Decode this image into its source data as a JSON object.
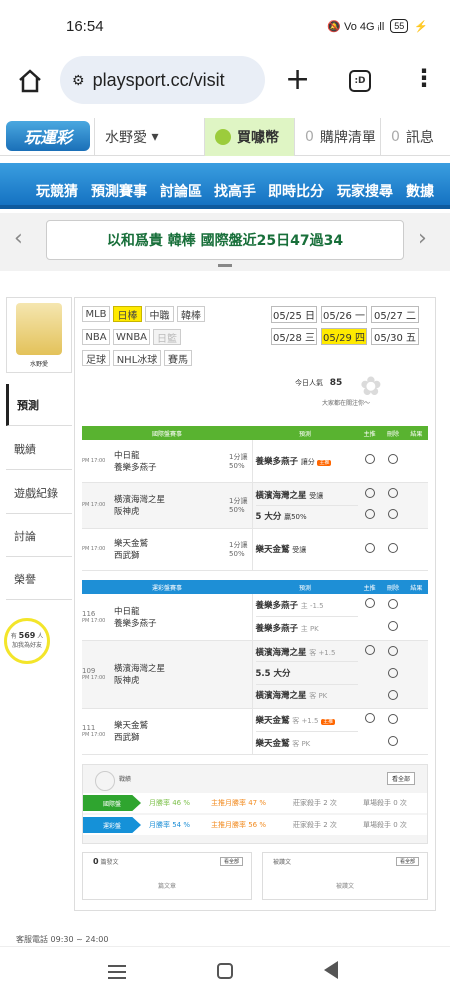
{
  "status": {
    "time": "16:54",
    "icons": "🔕 Vo 4G ᵢll",
    "battery": "55"
  },
  "browser": {
    "url": "playsport.cc/visit",
    "plus": "+",
    "tabs": ":D",
    "menu": "⋮"
  },
  "site": {
    "logo": "玩運彩",
    "user": "水野愛",
    "user_caret": "▾",
    "coins": "買噱幣",
    "cart_count": "0",
    "cart": "購牌清單",
    "msg_count": "0",
    "msg": "訊息"
  },
  "mainnav": [
    "玩競猜",
    "預測賽事",
    "討論區",
    "找高手",
    "即時比分",
    "玩家搜尋",
    "數據"
  ],
  "news": "以和爲貴 韓棒 國際盤近25日47過34",
  "sidebar": {
    "avatar_name": "水野愛",
    "items": [
      "預測",
      "戰績",
      "遊戲紀錄",
      "討論",
      "榮譽"
    ],
    "fans_prefix": "有",
    "fans": "569",
    "fans_unit": "人",
    "fans_text": "加我為好友"
  },
  "sports": [
    "MLB",
    "日棒",
    "中職",
    "韓棒",
    "NBA",
    "WNBA",
    "日籃",
    "足球",
    "NHL冰球",
    "賽馬"
  ],
  "dates": [
    "05/25 日",
    "05/26 一",
    "05/27 二",
    "05/28 三",
    "05/29 四",
    "05/30 五"
  ],
  "popularity": {
    "label": "今日人氣",
    "value": "85",
    "note": "大家都在關注你～"
  },
  "intl": {
    "header": [
      "國際盤賽事",
      "預測",
      "主推",
      "刪除",
      "結果"
    ],
    "games": [
      {
        "time": "PM 17:00",
        "teams": [
          "中日龍",
          "養樂多燕子"
        ],
        "line": "1分讓",
        "pct": "50%",
        "preds": [
          {
            "team": "養樂多燕子",
            "note": "讓分",
            "tag": "主推"
          }
        ]
      },
      {
        "time": "PM 17:00",
        "teams": [
          "橫濱海灣之星",
          "阪神虎"
        ],
        "line": "1分讓",
        "pct": "50%",
        "preds": [
          {
            "team": "橫濱海灣之星",
            "note": "受讓",
            "tag": ""
          },
          {
            "team": "5 大分",
            "note": "贏50%",
            "tag": ""
          }
        ]
      },
      {
        "time": "PM 17:00",
        "teams": [
          "樂天金鷲",
          "西武獅"
        ],
        "line": "1分讓",
        "pct": "50%",
        "preds": [
          {
            "team": "樂天金鷲",
            "note": "受讓",
            "tag": ""
          }
        ]
      }
    ]
  },
  "tw": {
    "header": [
      "運彩盤賽事",
      "預測",
      "主推",
      "刪除",
      "結果"
    ],
    "games": [
      {
        "no": "116",
        "time": "PM 17:00",
        "teams": [
          "中日龍",
          "養樂多燕子"
        ],
        "preds": [
          {
            "team": "養樂多燕子",
            "note": "主 -1.5",
            "tag": ""
          },
          {
            "team": "養樂多燕子",
            "note": "主 PK",
            "tag": ""
          }
        ]
      },
      {
        "no": "109",
        "time": "PM 17:00",
        "teams": [
          "橫濱海灣之星",
          "阪神虎"
        ],
        "preds": [
          {
            "team": "橫濱海灣之星",
            "note": "客 +1.5",
            "tag": ""
          },
          {
            "team": "5.5 大分",
            "note": "",
            "tag": ""
          },
          {
            "team": "橫濱海灣之星",
            "note": "客 PK",
            "tag": ""
          }
        ]
      },
      {
        "no": "111",
        "time": "PM 17:00",
        "teams": [
          "樂天金鷲",
          "西武獅"
        ],
        "preds": [
          {
            "team": "樂天金鷲",
            "note": "客 +1.5",
            "tag": "主推"
          },
          {
            "team": "樂天金鷲",
            "note": "客 PK",
            "tag": ""
          }
        ]
      }
    ]
  },
  "record": {
    "title": "戰績",
    "more": "看全部",
    "rows": [
      {
        "label": "國際盤",
        "win": "月勝率 46 %",
        "main": "主推月勝率 47 %",
        "master": "莊家殺手 2 次",
        "cont": "單場殺手 0 次",
        "color": "#2fa52f"
      },
      {
        "label": "運彩盤",
        "win": "月勝率 54 %",
        "main": "主推月勝率 56 %",
        "master": "莊家殺手 2 次",
        "cont": "單場殺手 0 次",
        "color": "#1591d8"
      }
    ]
  },
  "posts": {
    "left_count": "0",
    "left_title": "篇發文",
    "left_empty": "篇文章",
    "right_title": "被讚文",
    "right_empty": "被讚文",
    "more": "看全部"
  },
  "footer": {
    "service": "客服電話 09:30 ~ 24:00"
  },
  "colors": {
    "green": "#59b330",
    "blue": "#1e8fd6",
    "yellow": "#ffea00"
  }
}
